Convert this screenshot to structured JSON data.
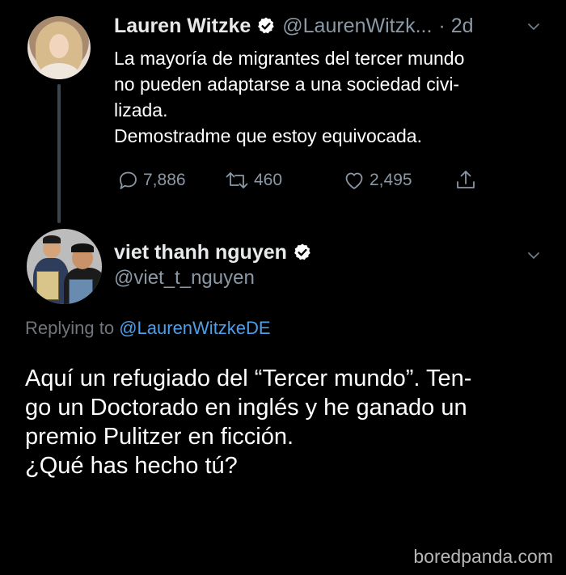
{
  "tweet1": {
    "display_name": "Lauren Witzke",
    "handle": "@LaurenWitzk...",
    "time": "· 2d",
    "text_lines": [
      "La mayoría de migrantes del tercer mundo",
      "no pueden adaptarse a una sociedad civi-",
      "lizada.",
      "Demostradme que estoy equivocada."
    ],
    "replies": "7,886",
    "retweets": "460",
    "likes": "2,495"
  },
  "tweet2": {
    "display_name": "viet thanh nguyen",
    "handle": "@viet_t_nguyen",
    "replying_prefix": "Replying to",
    "replying_to": "@LaurenWitzkeDE",
    "text_lines": [
      "Aquí un refugiado del “Tercer mundo”. Ten-",
      "go un Doctorado en inglés y he ganado un",
      "premio Pulitzer en ficción.",
      "¿Qué has hecho tú?"
    ]
  },
  "watermark": "boredpanda.com",
  "icons": {
    "verified": "verified-badge-icon",
    "chevron": "chevron-down-icon",
    "reply": "reply-icon",
    "retweet": "retweet-icon",
    "like": "heart-icon",
    "share": "share-icon"
  },
  "colors": {
    "background": "#000000",
    "muted": "#8b98a5",
    "link": "#4f9fe8",
    "thread_line": "#3a4650"
  }
}
